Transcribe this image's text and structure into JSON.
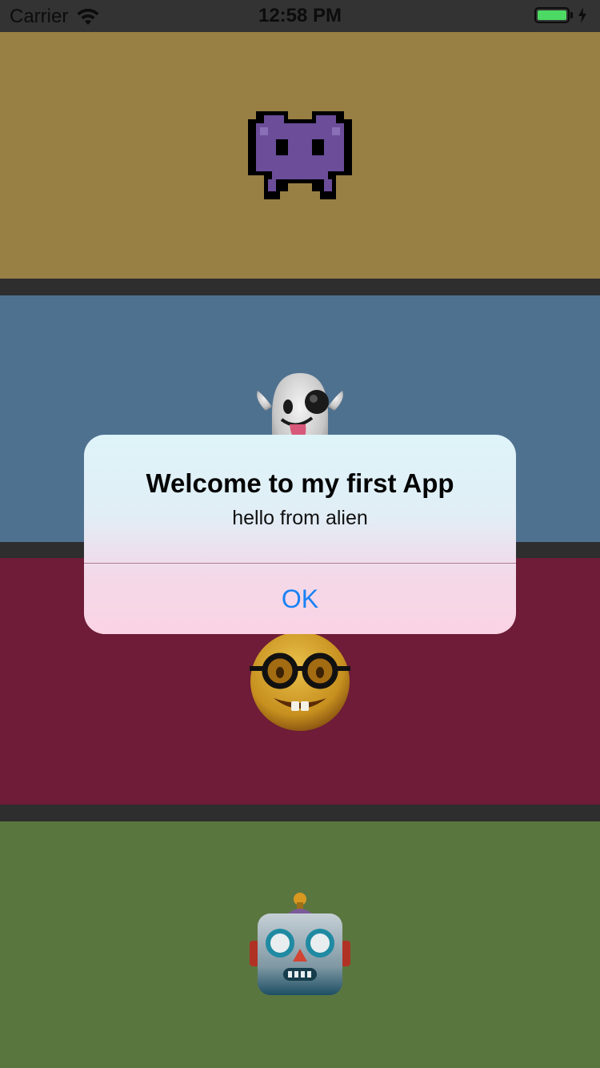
{
  "status_bar": {
    "carrier": "Carrier",
    "time": "12:58 PM",
    "battery_level": 1.0
  },
  "panels": [
    {
      "emoji": "alien-monster-icon",
      "color": "#987f44"
    },
    {
      "emoji": "ghost-icon",
      "color": "#4f7190"
    },
    {
      "emoji": "nerd-face-icon",
      "color": "#6e1c37"
    },
    {
      "emoji": "robot-icon",
      "color": "#5a763f"
    }
  ],
  "alert": {
    "title": "Welcome to my first App",
    "message": "hello from alien",
    "button_label": "OK",
    "button_color": "#1a82f5"
  }
}
